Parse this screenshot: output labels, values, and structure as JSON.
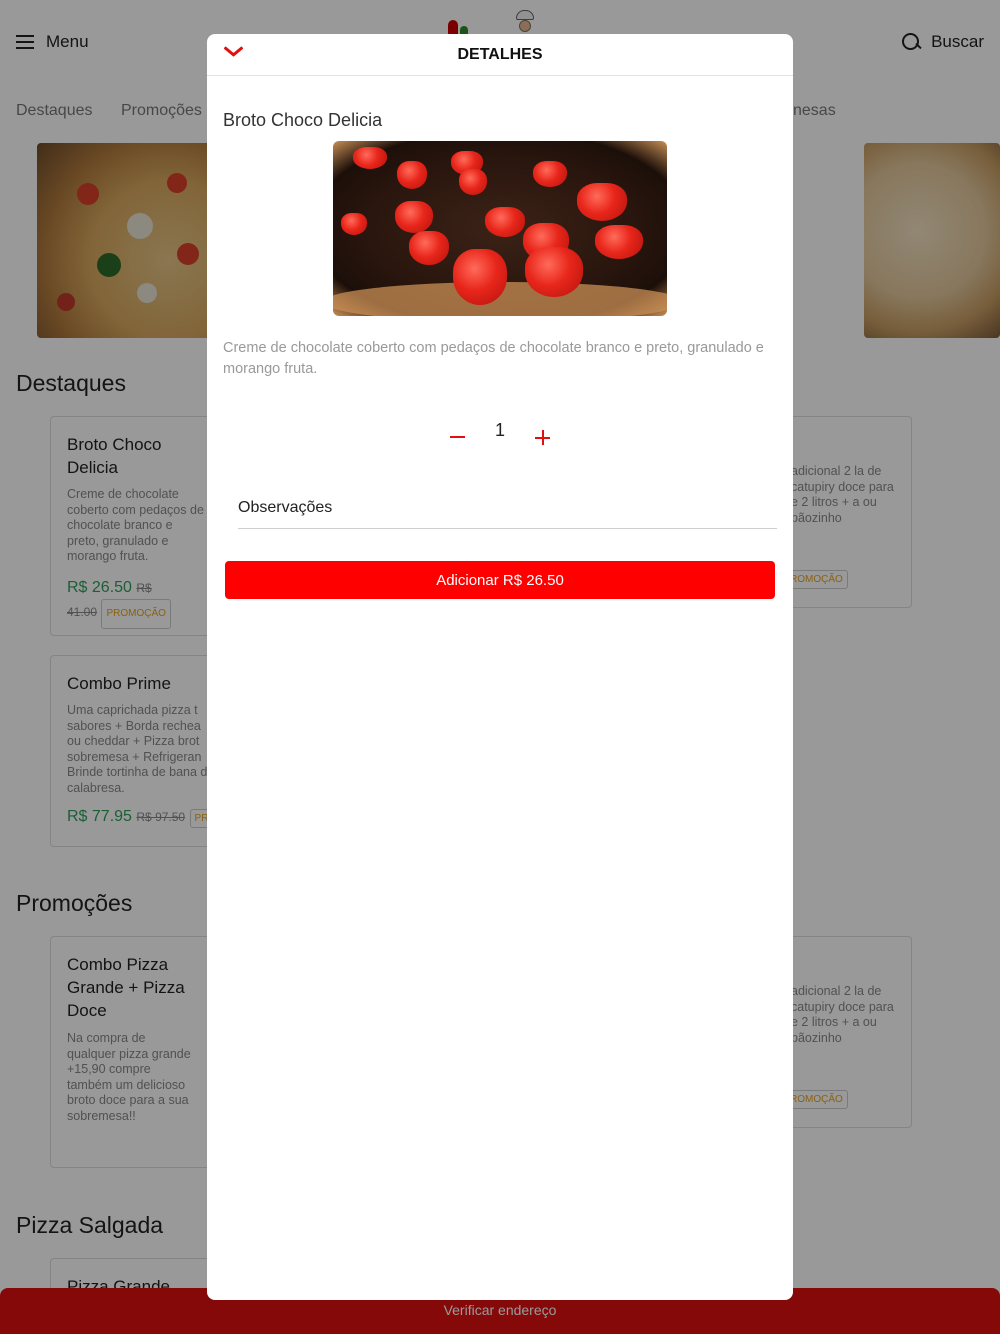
{
  "header": {
    "menu_label": "Menu",
    "search_label": "Buscar",
    "menu_icon": "hamburger-icon",
    "search_icon": "search-icon"
  },
  "tabs": [
    "Destaques",
    "Promoções",
    "nesas"
  ],
  "sections": {
    "destaques": {
      "title": "Destaques",
      "cards": [
        {
          "title": "Broto Choco Delicia",
          "description": "Creme de chocolate coberto com pedaços de chocolate branco e preto, granulado e morango fruta.",
          "price": "R$ 26.50",
          "old_price_prefix": "R$",
          "old_price": "41.00",
          "badge": "PROMOÇÃO"
        },
        {
          "title": "Combo Prime",
          "description": "Uma caprichada pizza t sabores + Borda rechea ou cheddar + Pizza brot sobremesa + Refrigeran Brinde tortinha de bana de calabresa.",
          "price": "R$ 77.95",
          "old_price": "R$ 97.50",
          "badge": "PR"
        },
        {
          "description": "adicional 2 la de catupiry doce para e 2 litros + a ou pãozinho",
          "badge": "ROMOÇÃO"
        }
      ]
    },
    "promocoes": {
      "title": "Promoções",
      "cards": [
        {
          "title": "Combo Pizza Grande + Pizza Doce",
          "description": "Na compra de qualquer pizza grande +15,90 compre também um delicioso broto doce para a sua sobremesa!!"
        },
        {
          "description": "adicional 2 la de catupiry doce para e 2 litros + a ou pãozinho",
          "badge": "ROMOÇÃO"
        }
      ]
    },
    "pizza_salgada": {
      "title": "Pizza Salgada",
      "cards": [
        {
          "title": "Pizza Grande"
        }
      ]
    }
  },
  "bottom_bar": {
    "label": "Verificar endereço"
  },
  "modal": {
    "title": "DETALHES",
    "close_icon": "chevron-down-icon",
    "product_name": "Broto Choco Delicia",
    "description": "Creme de chocolate coberto com pedaços de chocolate branco e preto, granulado e morango fruta.",
    "quantity": "1",
    "observations_placeholder": "Observações",
    "add_button_label": "Adicionar R$ 26.50"
  },
  "colors": {
    "accent": "#e01010",
    "button": "#ff0000",
    "price": "#2e9e5b",
    "badge": "#e8a21a"
  }
}
